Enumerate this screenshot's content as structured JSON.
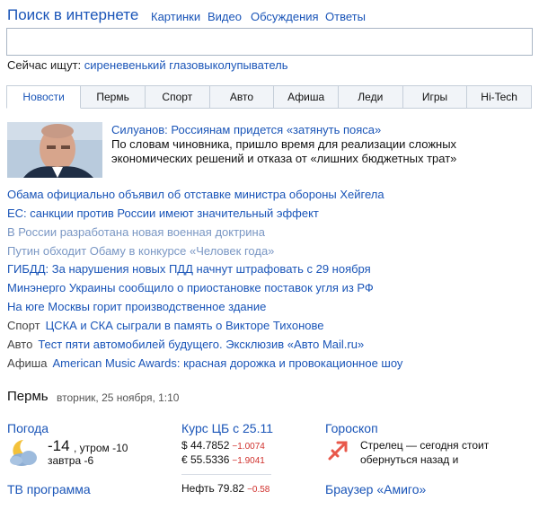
{
  "header": {
    "title": "Поиск в интернете",
    "tabs": [
      "Картинки",
      "Видео",
      "Обсуждения",
      "Ответы"
    ],
    "search_value": "",
    "now_searching_label": "Сейчас ищут:",
    "now_searching_query": "сиреневенький глазовыколупыватель"
  },
  "news_tabs": [
    "Новости",
    "Пермь",
    "Спорт",
    "Авто",
    "Афиша",
    "Леди",
    "Игры",
    "Hi-Tech"
  ],
  "top_story": {
    "headline": "Силуанов: Россиянам придется «затянуть пояса»",
    "summary": "По словам чиновника, пришло время для реализации сложных экономических решений и отказа от «лишних бюджетных трат»"
  },
  "news": [
    {
      "prefix": "",
      "text": "Обама официально объявил об отставке министра обороны Хейгела",
      "visited": false
    },
    {
      "prefix": "",
      "text": "ЕС: санкции против России имеют значительный эффект",
      "visited": false
    },
    {
      "prefix": "",
      "text": "В России разработана новая военная доктрина",
      "visited": true
    },
    {
      "prefix": "",
      "text": "Путин обходит Обаму в конкурсе «Человек года»",
      "visited": true
    },
    {
      "prefix": "",
      "text": "ГИБДД: За нарушения новых ПДД начнут штрафовать с 29 ноября",
      "visited": false
    },
    {
      "prefix": "",
      "text": "Минэнерго Украины сообщило о приостановке поставок угля из РФ",
      "visited": false
    },
    {
      "prefix": "",
      "text": "На юге Москвы горит производственное здание",
      "visited": false
    },
    {
      "prefix": "Спорт",
      "text": "ЦСКА и СКА сыграли в память о Викторе Тихонове",
      "visited": false
    },
    {
      "prefix": "Авто",
      "text": "Тест пяти автомобилей будущего. Эксклюзив «Авто Mail.ru»",
      "visited": false
    },
    {
      "prefix": "Афиша",
      "text": "American Music Awards: красная дорожка и провокационное шоу",
      "visited": false
    }
  ],
  "city": {
    "name": "Пермь",
    "date": "вторник, 25 ноября, 1:10"
  },
  "weather": {
    "title": "Погода",
    "now": "-14",
    "morning": ", утром -10",
    "tomorrow": "завтра -6",
    "icon": "moon-cloud-icon"
  },
  "rates": {
    "title": "Курс ЦБ с 25.11",
    "usd": {
      "value": "$ 44.7852",
      "change": "−1.0074"
    },
    "eur": {
      "value": "€ 55.5336",
      "change": "−1.9041"
    },
    "oil": {
      "value": "Нефть 79.82",
      "change": "−0.58"
    }
  },
  "horoscope": {
    "title": "Гороскоп",
    "text": "Стрелец — сегодня стоит обернуться назад и",
    "icon": "sagittarius-icon"
  },
  "footer_links": {
    "tv": "ТВ программа",
    "browser": "Браузер «Амиго»"
  },
  "colors": {
    "link": "#1a55b8",
    "visited_link": "#7a97c4",
    "negative": "#d0312d",
    "horoscope": "#e8584a"
  }
}
